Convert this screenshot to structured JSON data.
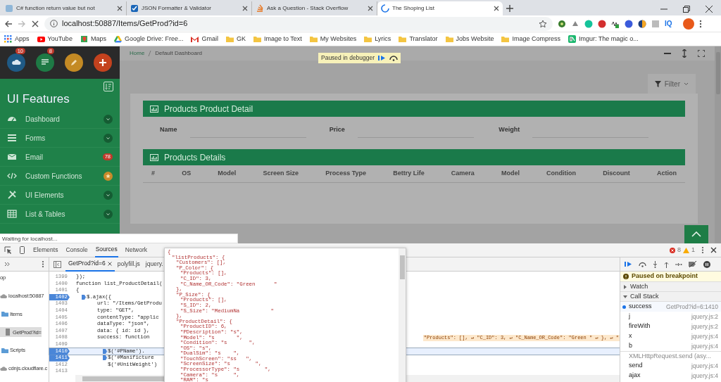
{
  "browser": {
    "tabs": [
      {
        "title": "C# function return value but not",
        "selected": false
      },
      {
        "title": "JSON Formatter & Validator",
        "selected": false
      },
      {
        "title": "Ask a Question - Stack Overflow",
        "selected": false
      },
      {
        "title": "The Shoping List",
        "selected": true
      }
    ],
    "address": "localhost:50887/Items/GetProd?id=6",
    "extension_label": "IQ",
    "bookmarks": [
      {
        "label": "Apps",
        "kind": "apps"
      },
      {
        "label": "YouTube",
        "kind": "youtube"
      },
      {
        "label": "Maps",
        "kind": "maps"
      },
      {
        "label": "Google Drive: Free...",
        "kind": "drive"
      },
      {
        "label": "Gmail",
        "kind": "gmail"
      },
      {
        "label": "GK",
        "kind": "folder"
      },
      {
        "label": "Image to Text",
        "kind": "folder"
      },
      {
        "label": "My Websites",
        "kind": "folder"
      },
      {
        "label": "Lyrics",
        "kind": "folder"
      },
      {
        "label": "Translator",
        "kind": "folder"
      },
      {
        "label": "Jobs Website",
        "kind": "folder"
      },
      {
        "label": "Image Compress",
        "kind": "folder"
      },
      {
        "label": "Imgur: The magic o...",
        "kind": "imgur"
      }
    ]
  },
  "page": {
    "quick_buttons": [
      {
        "kind": "cloud",
        "color": "#1f5a85",
        "badge": "10"
      },
      {
        "kind": "list",
        "color": "#1e7a45",
        "badge": "8"
      },
      {
        "kind": "pencil",
        "color": "#c48a24"
      },
      {
        "kind": "plus",
        "color": "#c4421e"
      }
    ],
    "sidebar_title": "UI Features",
    "menu": [
      {
        "label": "Dashboard",
        "kind": "chevron"
      },
      {
        "label": "Forms",
        "kind": "chevron"
      },
      {
        "label": "Email",
        "kind": "count",
        "badge": "78"
      },
      {
        "label": "Custom Functions",
        "kind": "star"
      },
      {
        "label": "UI Elements",
        "kind": "chevron"
      },
      {
        "label": "List & Tables",
        "kind": "chevron"
      }
    ],
    "breadcrumb": [
      "Home",
      "Default Dashboard"
    ],
    "debugger_banner": "Paused in debugger",
    "filter": "Filter",
    "detail_card": {
      "title": "Products Product Detail",
      "fields": [
        "Name",
        "Price",
        "Weight"
      ]
    },
    "table_card": {
      "title": "Products Details",
      "columns": [
        "#",
        "OS",
        "Model",
        "Screen Size",
        "Process Type",
        "Bettry Life",
        "Camera",
        "Model",
        "Condition",
        "Discount",
        "Action"
      ]
    },
    "status_bubble": "Waiting for localhost..."
  },
  "devtools": {
    "panel_tabs": [
      {
        "label": "Elements",
        "selected": false
      },
      {
        "label": "Console",
        "selected": false
      },
      {
        "label": "Sources",
        "selected": true
      },
      {
        "label": "Network",
        "selected": false
      }
    ],
    "errors": "8",
    "warnings": "1",
    "navigator": [
      {
        "label": "op",
        "selected": false,
        "children": [
          {
            "label": "localhost:50887",
            "kind": "cloud",
            "selected": false,
            "children": [
              {
                "label": "Items",
                "kind": "folder",
                "selected": false,
                "children": [
                  {
                    "label": "GetProd?id=",
                    "kind": "file",
                    "selected": true
                  }
                ]
              },
              {
                "label": "Scripts",
                "kind": "folder",
                "selected": false
              }
            ]
          },
          {
            "label": "cdnjs.cloudflare.c",
            "kind": "cloud",
            "selected": false
          }
        ]
      }
    ],
    "file_tabs": [
      {
        "label": "GetProd?id=6",
        "selected": true
      },
      {
        "label": "polyfill.js",
        "selected": false
      },
      {
        "label": "jquery.",
        "selected": false
      }
    ],
    "code": [
      {
        "number": "1399",
        "text": "});",
        "breakpoint": false,
        "current": false
      },
      {
        "number": "1400",
        "text": "function list_ProductDetail(",
        "breakpoint": false,
        "current": false
      },
      {
        "number": "1401",
        "text": "{",
        "breakpoint": false,
        "current": false,
        "children": [
          {
            "number": "1402",
            "text": "$.ajax({",
            "breakpoint": true,
            "current": false,
            "children": [
              {
                "number": "1403",
                "text": "url: \"/Items/GetProdu",
                "breakpoint": false,
                "current": false
              },
              {
                "number": "1404",
                "text": "type: \"GET\",",
                "breakpoint": false,
                "current": false
              },
              {
                "number": "1405",
                "text": "contentType: \"applic",
                "breakpoint": false,
                "current": false
              },
              {
                "number": "1406",
                "text": "dataType: \"json\",",
                "breakpoint": false,
                "current": false
              },
              {
                "number": "1407",
                "text": "data: { id: id },",
                "breakpoint": false,
                "current": false
              },
              {
                "number": "1408",
                "text": "success: function",
                "breakpoint": false,
                "current": false,
                "inline_value": "\"Products\": [], ↵ \"C_ID\": 3, ↵ \"C_Name_OR_Code\": \"Green \" ↵ }, ↵ \"",
                "children": [
                  {
                    "number": "1409",
                    "breakpoint": false,
                    "current": false
                  },
                  {
                    "number": "1410",
                    "text": "$('#PName').",
                    "breakpoint": true,
                    "current": true
                  },
                  {
                    "number": "1411",
                    "text": "$('#Manificture",
                    "breakpoint": true,
                    "current": false
                  },
                  {
                    "number": "1412",
                    "text": "$('#UnitWeight')",
                    "breakpoint": false,
                    "current": false
                  },
                  {
                    "number": "1413",
                    "breakpoint": false,
                    "current": false
                  }
                ]
              }
            ]
          }
        ]
      }
    ],
    "popup": [
      {
        "text": "{",
        "children": [
          {
            "text": "\"listProducts\": {",
            "children": [
              {
                "text": "\"Customers\": [],"
              },
              {
                "text": "\"P_Color\": {",
                "children": [
                  {
                    "text": "\"Products\": [],"
                  },
                  {
                    "text": "\"C_ID\": 3,"
                  },
                  {
                    "text": "\"C_Name_OR_Code\": \"Green      \""
                  }
                ]
              },
              {
                "text": "},"
              },
              {
                "text": "\"P_Size\": {",
                "children": [
                  {
                    "text": "\"Products\": [],"
                  },
                  {
                    "text": "\"S_ID\": 2,"
                  },
                  {
                    "text": "\"S_Size\": \"MediumNa          \""
                  }
                ]
              },
              {
                "text": "},"
              },
              {
                "text": "\"ProductDetail\": {",
                "children": [
                  {
                    "text": "\"ProductID\": 6,"
                  },
                  {
                    "text": "\"PDescription\": \"s\","
                  },
                  {
                    "text": "\"Model\": \"s       \","
                  },
                  {
                    "text": "\"Condition\": \"s       \","
                  },
                  {
                    "text": "\"OS\": \"s\","
                  },
                  {
                    "text": "\"DualSim\": \"s    \","
                  },
                  {
                    "text": "\"TouchScreen\": \"ss   \","
                  },
                  {
                    "text": "\"ScreenSize\": \"s        \","
                  },
                  {
                    "text": "\"ProcessorType\": \"s        \","
                  },
                  {
                    "text": "\"Camera\": \"s     \","
                  },
                  {
                    "text": "\"RAM\": \"s"
                  }
                ]
              }
            ]
          }
        ]
      }
    ],
    "paused_message": "Paused on breakpoint",
    "sections": [
      {
        "label": "Watch",
        "expanded": false
      },
      {
        "label": "Call Stack",
        "expanded": true
      }
    ],
    "frames": [
      {
        "kind": "frame",
        "name": "success",
        "location": "GetProd?id=6:1410",
        "selected": true
      },
      {
        "kind": "frame",
        "name": "j",
        "location": "jquery.js:2",
        "selected": false
      },
      {
        "kind": "frame",
        "name": "fireWith",
        "location": "jquery.js:2",
        "selected": false
      },
      {
        "kind": "frame",
        "name": "x",
        "location": "jquery.js:4",
        "selected": false
      },
      {
        "kind": "frame",
        "name": "b",
        "location": "jquery.js:4",
        "selected": false
      },
      {
        "kind": "async",
        "name": "XMLHttpRequest.send (asy..."
      },
      {
        "kind": "frame",
        "name": "send",
        "location": "jquery.js:4",
        "selected": false
      },
      {
        "kind": "frame",
        "name": "ajax",
        "location": "jquery.js:4",
        "selected": false
      }
    ]
  }
}
